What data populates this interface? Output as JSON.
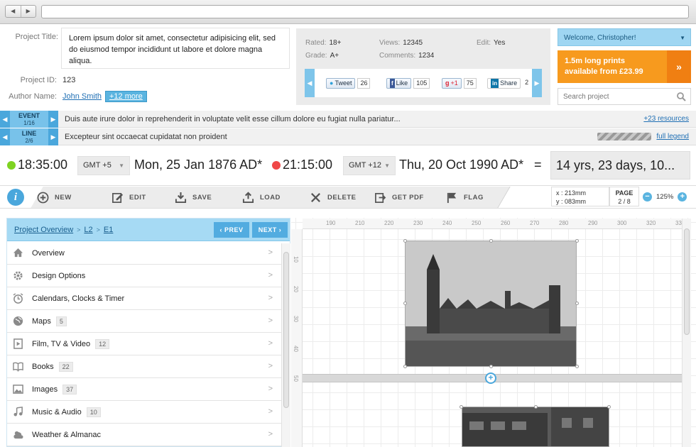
{
  "project": {
    "title_label": "Project Title:",
    "title_value": "Lorem ipsum dolor sit amet, consectetur adipisicing elit, sed do eiusmod tempor incididunt ut labore et dolore magna aliqua.",
    "id_label": "Project ID:",
    "id_value": "123",
    "author_label": "Author Name:",
    "author_value": "John Smith",
    "more_label": "+12 more"
  },
  "stats": {
    "rated_label": "Rated:",
    "rated_value": "18+",
    "views_label": "Views:",
    "views_value": "12345",
    "edit_label": "Edit:",
    "edit_value": "Yes",
    "grade_label": "Grade:",
    "grade_value": "A+",
    "comments_label": "Comments:",
    "comments_value": "1234"
  },
  "share": {
    "tweet_label": "Tweet",
    "tweet_count": "26",
    "like_label": "Like",
    "like_count": "105",
    "gplus_label": "+1",
    "gplus_count": "75",
    "linkedin_label": "Share",
    "linkedin_count": "2"
  },
  "user": {
    "welcome": "Welcome, Christopher!",
    "promo_line1": "1.5m long prints",
    "promo_line2": "available from £23.99",
    "search_placeholder": "Search project"
  },
  "event_row": {
    "label": "EVENT",
    "position": "1/16",
    "text": "Duis aute irure dolor in reprehenderit in voluptate velit esse cillum dolore eu fugiat nulla pariatur...",
    "link": "+23 resources"
  },
  "line_row": {
    "label": "LINE",
    "position": "2/6",
    "text": "Excepteur sint occaecat cupidatat non proident",
    "link": "full legend"
  },
  "time": {
    "start_time": "18:35:00",
    "start_zone": "GMT +5",
    "start_date": "Mon, 25 Jan 1876 AD*",
    "end_time": "21:15:00",
    "end_zone": "GMT +12",
    "end_date": "Thu, 20 Oct 1990 AD*",
    "equals": "=",
    "result": "14 yrs, 23 days, 10...",
    "colors": {
      "start_dot": "#7ed321",
      "end_dot": "#f04848"
    }
  },
  "toolbar": {
    "info": "i",
    "new_label": "NEW",
    "edit_label": "EDIT",
    "save_label": "SAVE",
    "load_label": "LOAD",
    "delete_label": "DELETE",
    "pdf_label": "GET PDF",
    "flag_label": "FLAG",
    "coord_x": "x : 213mm",
    "coord_y": "y : 083mm",
    "page_label": "PAGE",
    "page_value": "2 / 8",
    "zoom_out": "−",
    "zoom_value": "125%",
    "zoom_in": "+"
  },
  "nav": {
    "crumb_root": "Project Overview",
    "crumb_l2": "L2",
    "crumb_e1": "E1",
    "prev_label": "PREV",
    "next_label": "NEXT",
    "items": [
      {
        "label": "Overview",
        "badge": "",
        "icon": "home-icon"
      },
      {
        "label": "Design Options",
        "badge": "",
        "icon": "gear-icon"
      },
      {
        "label": "Calendars, Clocks & Timer",
        "badge": "",
        "icon": "alarm-clock-icon"
      },
      {
        "label": "Maps",
        "badge": "5",
        "icon": "globe-icon"
      },
      {
        "label": "Film, TV & Video",
        "badge": "12",
        "icon": "film-icon"
      },
      {
        "label": "Books",
        "badge": "22",
        "icon": "book-icon"
      },
      {
        "label": "Images",
        "badge": "37",
        "icon": "image-icon"
      },
      {
        "label": "Music & Audio",
        "badge": "10",
        "icon": "music-note-icon"
      },
      {
        "label": "Weather & Almanac",
        "badge": "",
        "icon": "weather-icon"
      }
    ]
  },
  "ruler": {
    "top": [
      "190",
      "210",
      "220",
      "230",
      "240",
      "250",
      "260",
      "270",
      "280",
      "290",
      "300",
      "320",
      "33"
    ],
    "left": [
      "10",
      "20",
      "30",
      "40",
      "50"
    ]
  },
  "accent": "#4aa7dc"
}
